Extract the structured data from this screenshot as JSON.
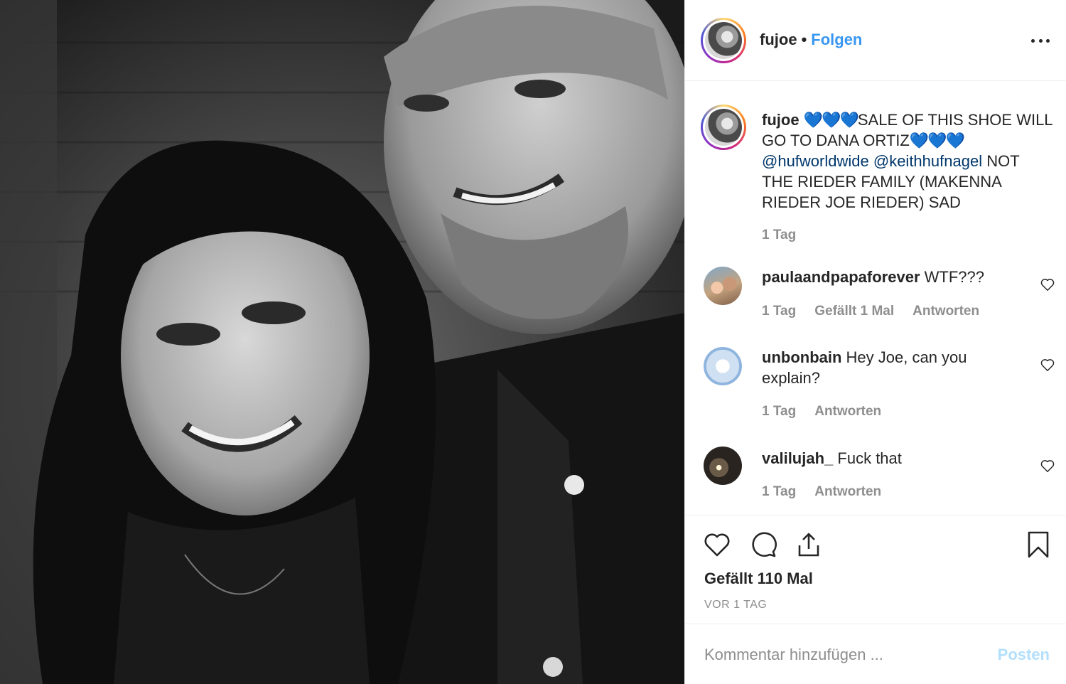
{
  "post": {
    "username": "fujoe",
    "separator": "•",
    "follow_label": "Folgen",
    "more_icon": "more-horizontal-icon"
  },
  "caption": {
    "username": "fujoe",
    "hearts_1": "💙💙💙",
    "text_1": "SALE OF THIS SHOE WILL GO TO DANA ORTIZ",
    "hearts_2": "💙💙💙",
    "mention_1": "@hufworldwide",
    "mention_2": "@keithhufnagel",
    "text_2": " NOT THE RIEDER FAMILY (MAKENNA RIEDER JOE RIEDER) SAD",
    "time": "1 Tag"
  },
  "comments": [
    {
      "username": "paulaandpapaforever",
      "text": "WTF???",
      "time": "1 Tag",
      "likes": "Gefällt 1 Mal",
      "reply": "Antworten"
    },
    {
      "username": "unbonbain",
      "text": "Hey Joe, can you explain?",
      "time": "1 Tag",
      "reply": "Antworten"
    },
    {
      "username": "valilujah_",
      "text": "Fuck that",
      "time": "1 Tag",
      "reply": "Antworten"
    }
  ],
  "actions": {
    "like_icon": "heart-icon",
    "comment_icon": "comment-bubble-icon",
    "share_icon": "share-upload-icon",
    "save_icon": "bookmark-icon",
    "likes_count": "Gefällt 110 Mal",
    "post_time": "VOR 1 TAG"
  },
  "comment_form": {
    "placeholder": "Kommentar hinzufügen ...",
    "submit_label": "Posten"
  }
}
